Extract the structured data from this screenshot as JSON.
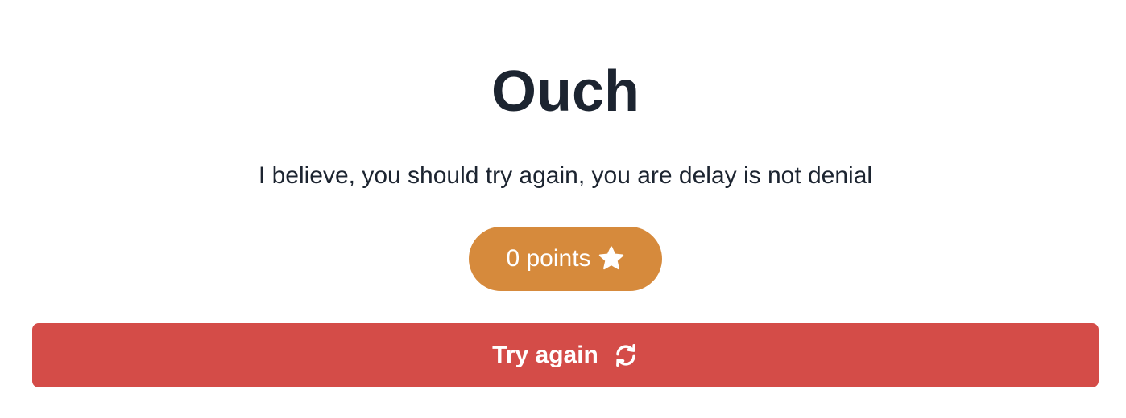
{
  "result": {
    "title": "Ouch",
    "message": "I believe, you should try again, you are delay is not denial"
  },
  "points_badge": {
    "label": "0 points",
    "icon": "star-icon",
    "color": "#d68a3c"
  },
  "retry_button": {
    "label": "Try again",
    "icon": "refresh-icon",
    "color": "#d44c48"
  },
  "colors": {
    "text": "#1c2430",
    "background": "#ffffff"
  }
}
